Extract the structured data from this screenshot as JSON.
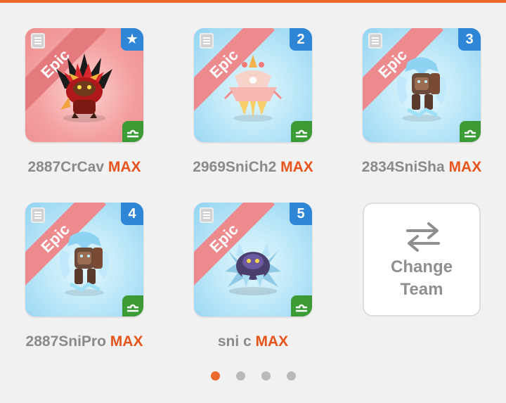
{
  "monsters": [
    {
      "rarity": "Epic",
      "slot_badge": "★",
      "name": "2887CrCav",
      "level_tag": "MAX",
      "element": "fire",
      "icon": "doc-icon"
    },
    {
      "rarity": "Epic",
      "slot_badge": "2",
      "name": "2969SniCh2",
      "level_tag": "MAX",
      "element": "water",
      "icon": "doc-icon"
    },
    {
      "rarity": "Epic",
      "slot_badge": "3",
      "name": "2834SniSha",
      "level_tag": "MAX",
      "element": "water",
      "icon": "doc-icon"
    },
    {
      "rarity": "Epic",
      "slot_badge": "4",
      "name": "2887SniPro",
      "level_tag": "MAX",
      "element": "water",
      "icon": "doc-icon"
    },
    {
      "rarity": "Epic",
      "slot_badge": "5",
      "name": "sni c",
      "level_tag": "MAX",
      "element": "water",
      "icon": "doc-icon"
    }
  ],
  "change_team": {
    "label_line1": "Change",
    "label_line2": "Team",
    "icon": "swap-arrows-icon"
  },
  "pagination": {
    "page_count": 4,
    "current_page": 1
  },
  "colors": {
    "accent": "#e96a2b",
    "max_tag": "#e6541c",
    "badge_blue": "#2f86d6",
    "element_green": "#3c9b35"
  }
}
